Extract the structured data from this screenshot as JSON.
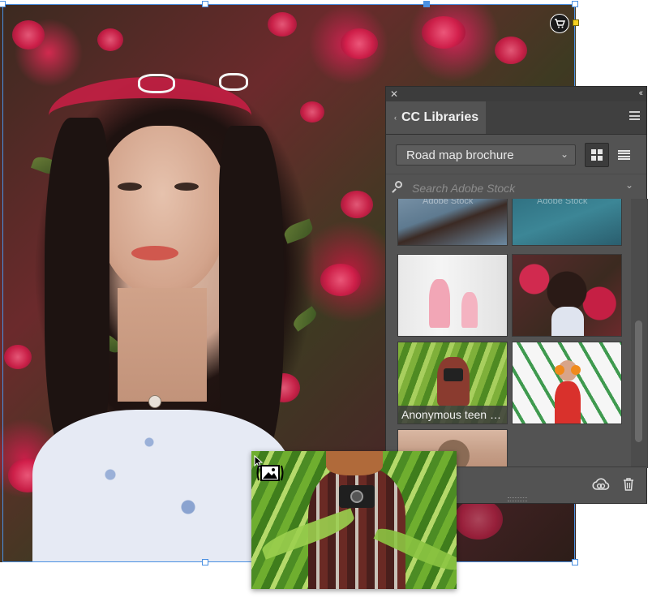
{
  "canvas": {
    "accent_color": "#4a90e2",
    "stock_badge_icon": "shopping-cart-icon"
  },
  "panel": {
    "close_icon": "close-icon",
    "collapse_icon": "double-chevron-icon",
    "tab_title": "CC Libraries",
    "library_selected": "Road map brochure",
    "view_modes": [
      "grid",
      "list"
    ],
    "active_view": "grid",
    "search_placeholder": "Search Adobe Stock",
    "thumbnails": [
      {
        "caption": "",
        "watermark": "Adobe Stock"
      },
      {
        "caption": "",
        "watermark": "Adobe Stock"
      },
      {
        "caption": "",
        "watermark": ""
      },
      {
        "caption": "",
        "watermark": ""
      },
      {
        "caption": "Anonymous teen …",
        "watermark": ""
      },
      {
        "caption": "",
        "watermark": ""
      },
      {
        "caption": "",
        "watermark": ""
      }
    ],
    "footer_icons": [
      "creative-cloud-icon",
      "trash-icon"
    ]
  },
  "drag": {
    "cursor_icon": "place-image-icon"
  }
}
